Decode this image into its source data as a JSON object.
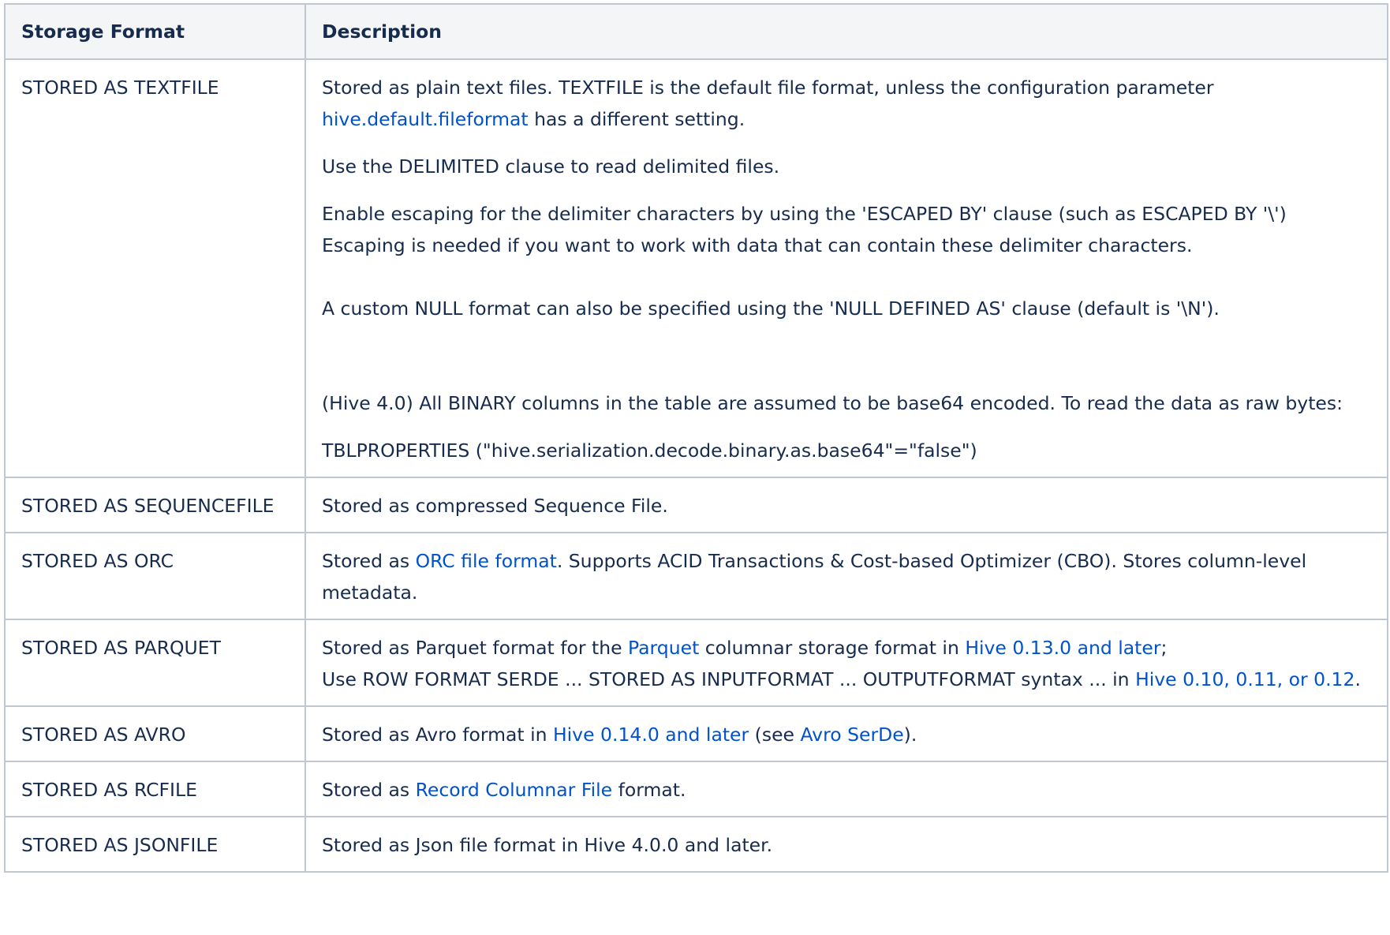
{
  "table": {
    "headers": {
      "format": "Storage Format",
      "description": "Description"
    },
    "rows": [
      {
        "format": "STORED AS TEXTFILE",
        "p1_a": "Stored as plain text files. TEXTFILE is the default file format, unless the configuration parameter ",
        "p1_link": "hive.default.fileformat",
        "p1_b": " has a different setting.",
        "p2": "Use the DELIMITED clause to read delimited files.",
        "p3": "Enable escaping for the delimiter characters by using the 'ESCAPED BY' clause (such as ESCAPED BY '\\')",
        "p3b": "Escaping is needed if you want to work with data that can contain these delimiter characters.",
        "p4": "A custom NULL format can also be specified using the 'NULL DEFINED AS' clause (default is '\\N').",
        "p5": "(Hive 4.0) All BINARY columns in the table are assumed to be base64 encoded.  To read the data as raw bytes:",
        "p6": "TBLPROPERTIES (\"hive.serialization.decode.binary.as.base64\"=\"false\")"
      },
      {
        "format": "STORED AS SEQUENCEFILE",
        "text": "Stored as compressed Sequence File."
      },
      {
        "format": "STORED AS ORC",
        "a": "Stored as ",
        "link": "ORC file format",
        "b": ". Supports ACID Transactions & Cost-based Optimizer (CBO). Stores column-level metadata."
      },
      {
        "format": "STORED AS PARQUET",
        "a": "Stored as Parquet format for the ",
        "link1": "Parquet",
        "b": " columnar storage format in ",
        "link2": "Hive 0.13.0 and later",
        "c": ";",
        "d": "Use ROW FORMAT SERDE ... STORED AS INPUTFORMAT ... OUTPUTFORMAT syntax ... in ",
        "link3": "Hive 0.10, 0.11, or 0.12",
        "e": "."
      },
      {
        "format": "STORED AS AVRO",
        "a": "Stored as Avro format in ",
        "link1": "Hive 0.14.0 and later",
        "b": " (see ",
        "link2": "Avro SerDe",
        "c": ")."
      },
      {
        "format": "STORED AS RCFILE",
        "a": "Stored as ",
        "link": "Record Columnar File",
        "b": " format."
      },
      {
        "format": "STORED AS JSONFILE",
        "text": "Stored as Json file format in Hive 4.0.0 and later."
      }
    ]
  },
  "colors": {
    "text": "#172b4d",
    "link": "#0052cc",
    "border": "#c1c7d0",
    "header_bg": "#f4f5f7"
  }
}
